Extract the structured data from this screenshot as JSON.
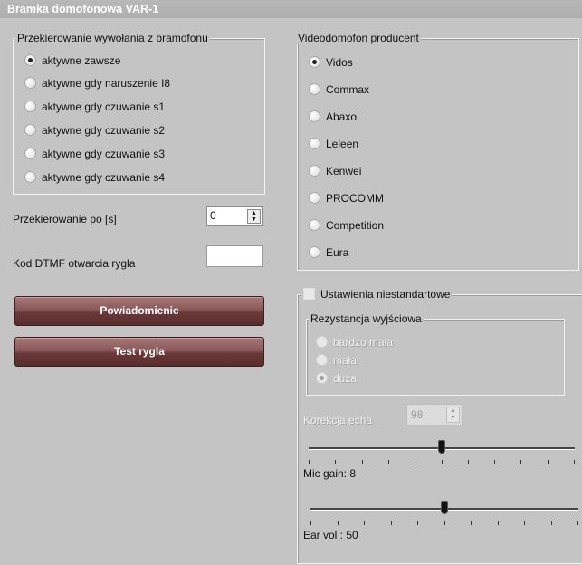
{
  "window": {
    "title": "Bramka domofonowa VAR-1"
  },
  "redirect_group": {
    "legend": "Przekierowanie wywołania z bramofonu",
    "options": [
      {
        "label": "aktywne zawsze",
        "selected": true
      },
      {
        "label": "aktywne gdy naruszenie I8",
        "selected": false
      },
      {
        "label": "aktywne gdy czuwanie s1",
        "selected": false
      },
      {
        "label": "aktywne gdy czuwanie s2",
        "selected": false
      },
      {
        "label": "aktywne gdy czuwanie s3",
        "selected": false
      },
      {
        "label": "aktywne gdy czuwanie s4",
        "selected": false
      }
    ]
  },
  "redirect_after": {
    "label": "Przekierowanie po [s]",
    "value": "0"
  },
  "dtmf": {
    "label": "Kod DTMF otwarcia rygla",
    "value": ""
  },
  "buttons": {
    "notify": "Powiadomienie",
    "test_lock": "Test rygla"
  },
  "producer_group": {
    "legend": "Videodomofon producent",
    "options": [
      {
        "label": "Vidos",
        "selected": true
      },
      {
        "label": "Commax",
        "selected": false
      },
      {
        "label": "Abaxo",
        "selected": false
      },
      {
        "label": "Leleen",
        "selected": false
      },
      {
        "label": "Kenwei",
        "selected": false
      },
      {
        "label": "PROCOMM",
        "selected": false
      },
      {
        "label": "Competition",
        "selected": false
      },
      {
        "label": "Eura",
        "selected": false
      }
    ]
  },
  "custom": {
    "checkbox_label": "Ustawienia niestandartowe",
    "checked": false,
    "resistance_legend": "Rezystancja wyjściowa",
    "resistance_options": [
      {
        "label": "bardzo mała",
        "selected": false
      },
      {
        "label": "mała",
        "selected": false
      },
      {
        "label": "duża",
        "selected": true
      }
    ],
    "echo_label": "Korekcja echa",
    "echo_value": "98",
    "mic_gain_label": "Mic gain: 8",
    "mic_gain_level": 0.5,
    "ear_vol_label": "Ear vol : 50",
    "ear_vol_level": 0.5
  }
}
